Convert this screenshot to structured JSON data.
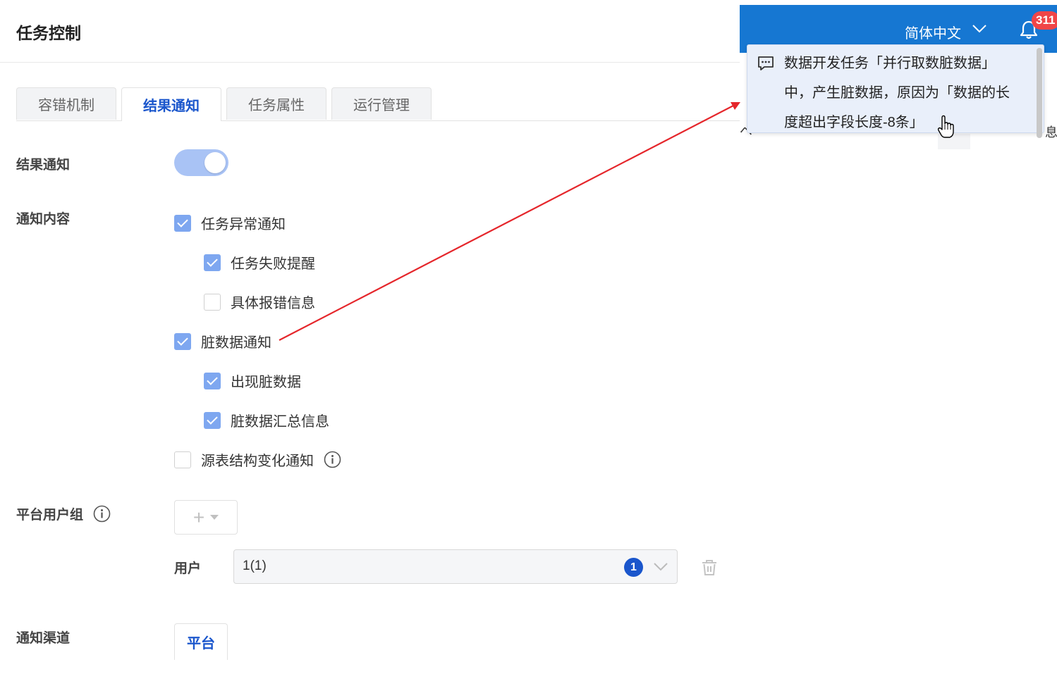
{
  "page": {
    "title": "任务控制"
  },
  "tabs": [
    {
      "label": "容错机制",
      "active": false
    },
    {
      "label": "结果通知",
      "active": true
    },
    {
      "label": "任务属性",
      "active": false
    },
    {
      "label": "运行管理",
      "active": false
    }
  ],
  "result_notify": {
    "label": "结果通知",
    "enabled": true
  },
  "notify_content": {
    "label": "通知内容",
    "options": [
      {
        "label": "任务异常通知",
        "checked": true
      },
      {
        "label": "任务失败提醒",
        "checked": true
      },
      {
        "label": "具体报错信息",
        "checked": false
      },
      {
        "label": "脏数据通知",
        "checked": true
      },
      {
        "label": "出现脏数据",
        "checked": true
      },
      {
        "label": "脏数据汇总信息",
        "checked": true
      },
      {
        "label": "源表结构变化通知",
        "checked": false
      }
    ]
  },
  "user_group": {
    "label": "平台用户组",
    "add_symbol": "+",
    "user_label": "用户",
    "user_value": "1(1)",
    "user_count": "1"
  },
  "channel": {
    "label": "通知渠道",
    "tab_label": "平台"
  },
  "header": {
    "language": "简体中文",
    "notification_count": "311"
  },
  "notification": {
    "line1": "数据开发任务「并行取数脏数据」",
    "line2": "中，产生脏数据，原因为「数据的长",
    "line3": "度超出字段长度-8条」"
  },
  "background_peek": {
    "left_fragment": "ペ",
    "right_fragment": "息"
  },
  "colors": {
    "primary": "#1a56cc",
    "topbar": "#1677d2",
    "checkbox_checked": "#7ea7f0",
    "switch_on": "#a9c3f5",
    "badge": "#f04548",
    "annotation_arrow": "#e5262b",
    "notification_bg": "#e9effa"
  },
  "icons": [
    "info-icon",
    "plus-icon",
    "caret-down-icon",
    "chevron-down-icon",
    "trash-icon",
    "bell-icon",
    "message-icon",
    "hand-cursor-icon"
  ]
}
